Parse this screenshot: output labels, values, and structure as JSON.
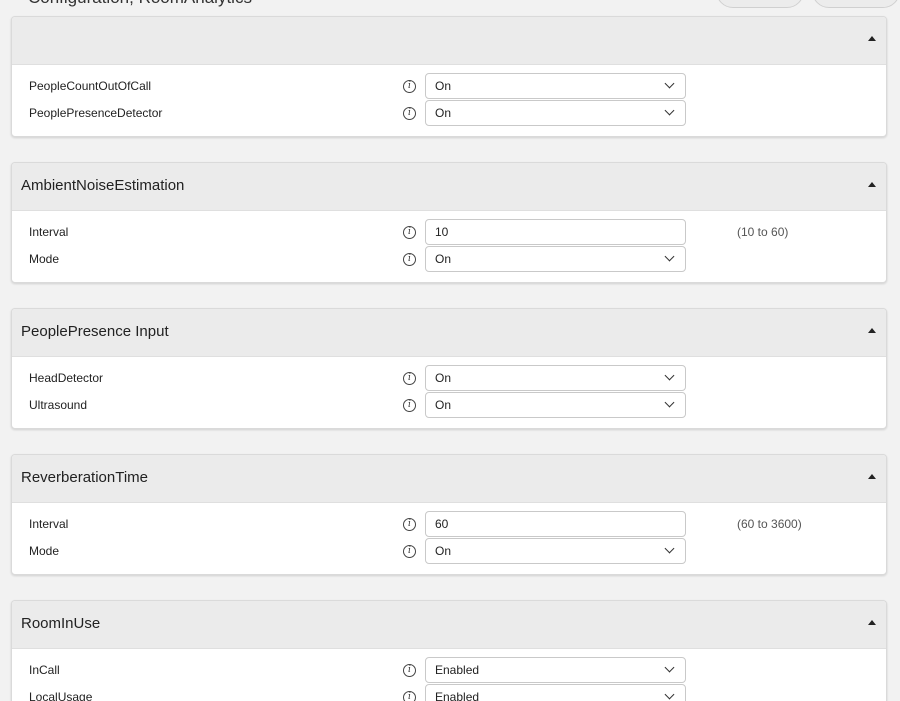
{
  "header": {
    "title": "Configuration, RoomAnalytics"
  },
  "sections": [
    {
      "title": "",
      "rows": [
        {
          "label": "PeopleCountOutOfCall",
          "value": "On",
          "control": "select"
        },
        {
          "label": "PeoplePresenceDetector",
          "value": "On",
          "control": "select"
        }
      ]
    },
    {
      "title": "AmbientNoiseEstimation",
      "rows": [
        {
          "label": "Interval",
          "value": "10",
          "control": "text",
          "hint": "(10 to 60)"
        },
        {
          "label": "Mode",
          "value": "On",
          "control": "select"
        }
      ]
    },
    {
      "title": "PeoplePresence Input",
      "rows": [
        {
          "label": "HeadDetector",
          "value": "On",
          "control": "select"
        },
        {
          "label": "Ultrasound",
          "value": "On",
          "control": "select"
        }
      ]
    },
    {
      "title": "ReverberationTime",
      "rows": [
        {
          "label": "Interval",
          "value": "60",
          "control": "text",
          "hint": "(60 to 3600)"
        },
        {
          "label": "Mode",
          "value": "On",
          "control": "select"
        }
      ]
    },
    {
      "title": "RoomInUse",
      "rows": [
        {
          "label": "InCall",
          "value": "Enabled",
          "control": "select"
        },
        {
          "label": "LocalUsage",
          "value": "Enabled",
          "control": "select"
        }
      ]
    }
  ]
}
